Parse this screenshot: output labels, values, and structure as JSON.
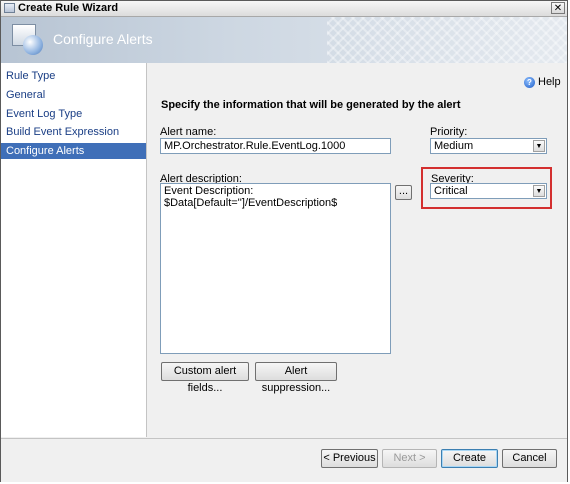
{
  "window": {
    "title": "Create Rule Wizard",
    "close_glyph": "✕"
  },
  "header": {
    "title": "Configure Alerts"
  },
  "sidebar": {
    "items": [
      {
        "label": "Rule Type",
        "active": false
      },
      {
        "label": "General",
        "active": false
      },
      {
        "label": "Event Log Type",
        "active": false
      },
      {
        "label": "Build Event Expression",
        "active": false
      },
      {
        "label": "Configure Alerts",
        "active": true
      }
    ]
  },
  "help": {
    "label": "Help",
    "glyph": "?"
  },
  "main": {
    "instruction": "Specify the information that will be generated by the alert",
    "alert_name": {
      "label": "Alert name:",
      "value": "MP.Orchestrator.Rule.EventLog.1000"
    },
    "priority": {
      "label": "Priority:",
      "value": "Medium"
    },
    "alert_description": {
      "label": "Alert description:",
      "value": "Event Description: $Data[Default='']/EventDescription$"
    },
    "ellipsis_button": "...",
    "severity": {
      "label": "Severity:",
      "value": "Critical"
    },
    "custom_alert_fields_button": "Custom alert fields...",
    "alert_suppression_button": "Alert suppression..."
  },
  "footer": {
    "previous": "< Previous",
    "next": "Next >",
    "create": "Create",
    "cancel": "Cancel"
  },
  "colors": {
    "accent": "#3f6fb8",
    "highlight": "#d32f2f"
  }
}
